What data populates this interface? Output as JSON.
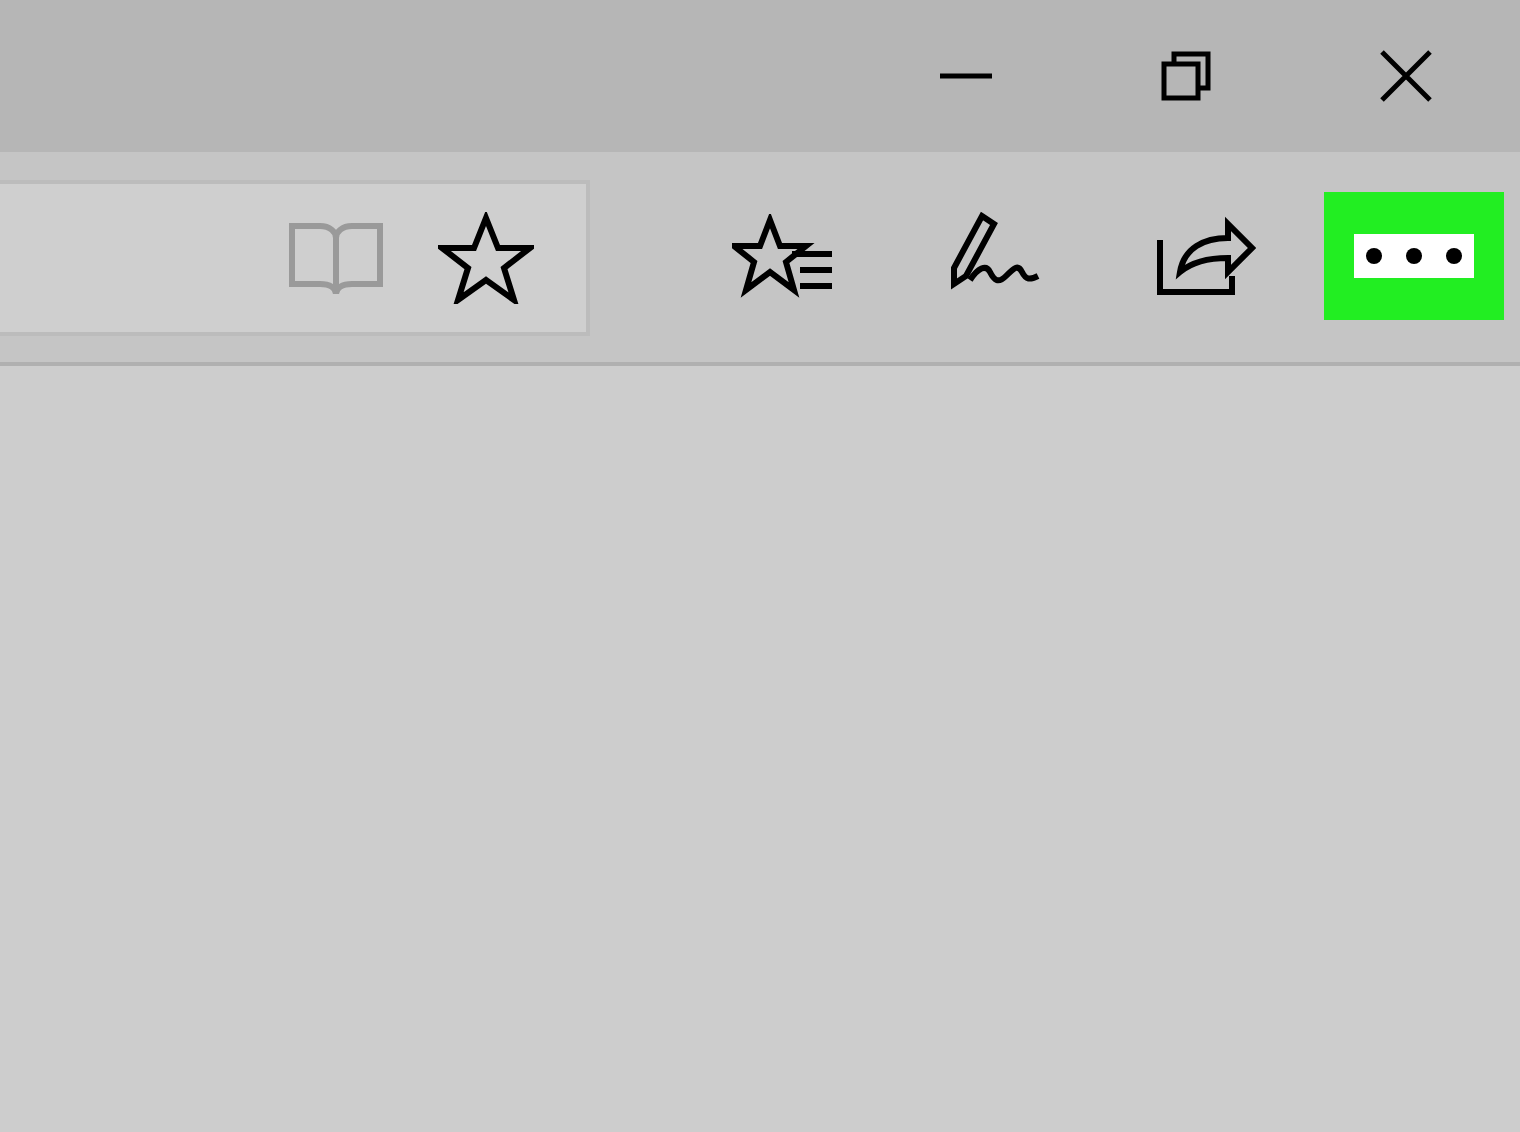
{
  "window_controls": [
    {
      "kind": "minimize"
    },
    {
      "kind": "maximize"
    },
    {
      "kind": "close"
    }
  ],
  "address_bar": {
    "icons": [
      {
        "kind": "reading-view",
        "disabled": true
      },
      {
        "kind": "favorite",
        "disabled": false
      }
    ]
  },
  "toolbar": [
    {
      "kind": "hub",
      "highlighted": false
    },
    {
      "kind": "notes",
      "highlighted": false
    },
    {
      "kind": "share",
      "highlighted": false
    },
    {
      "kind": "more",
      "highlighted": true
    }
  ]
}
